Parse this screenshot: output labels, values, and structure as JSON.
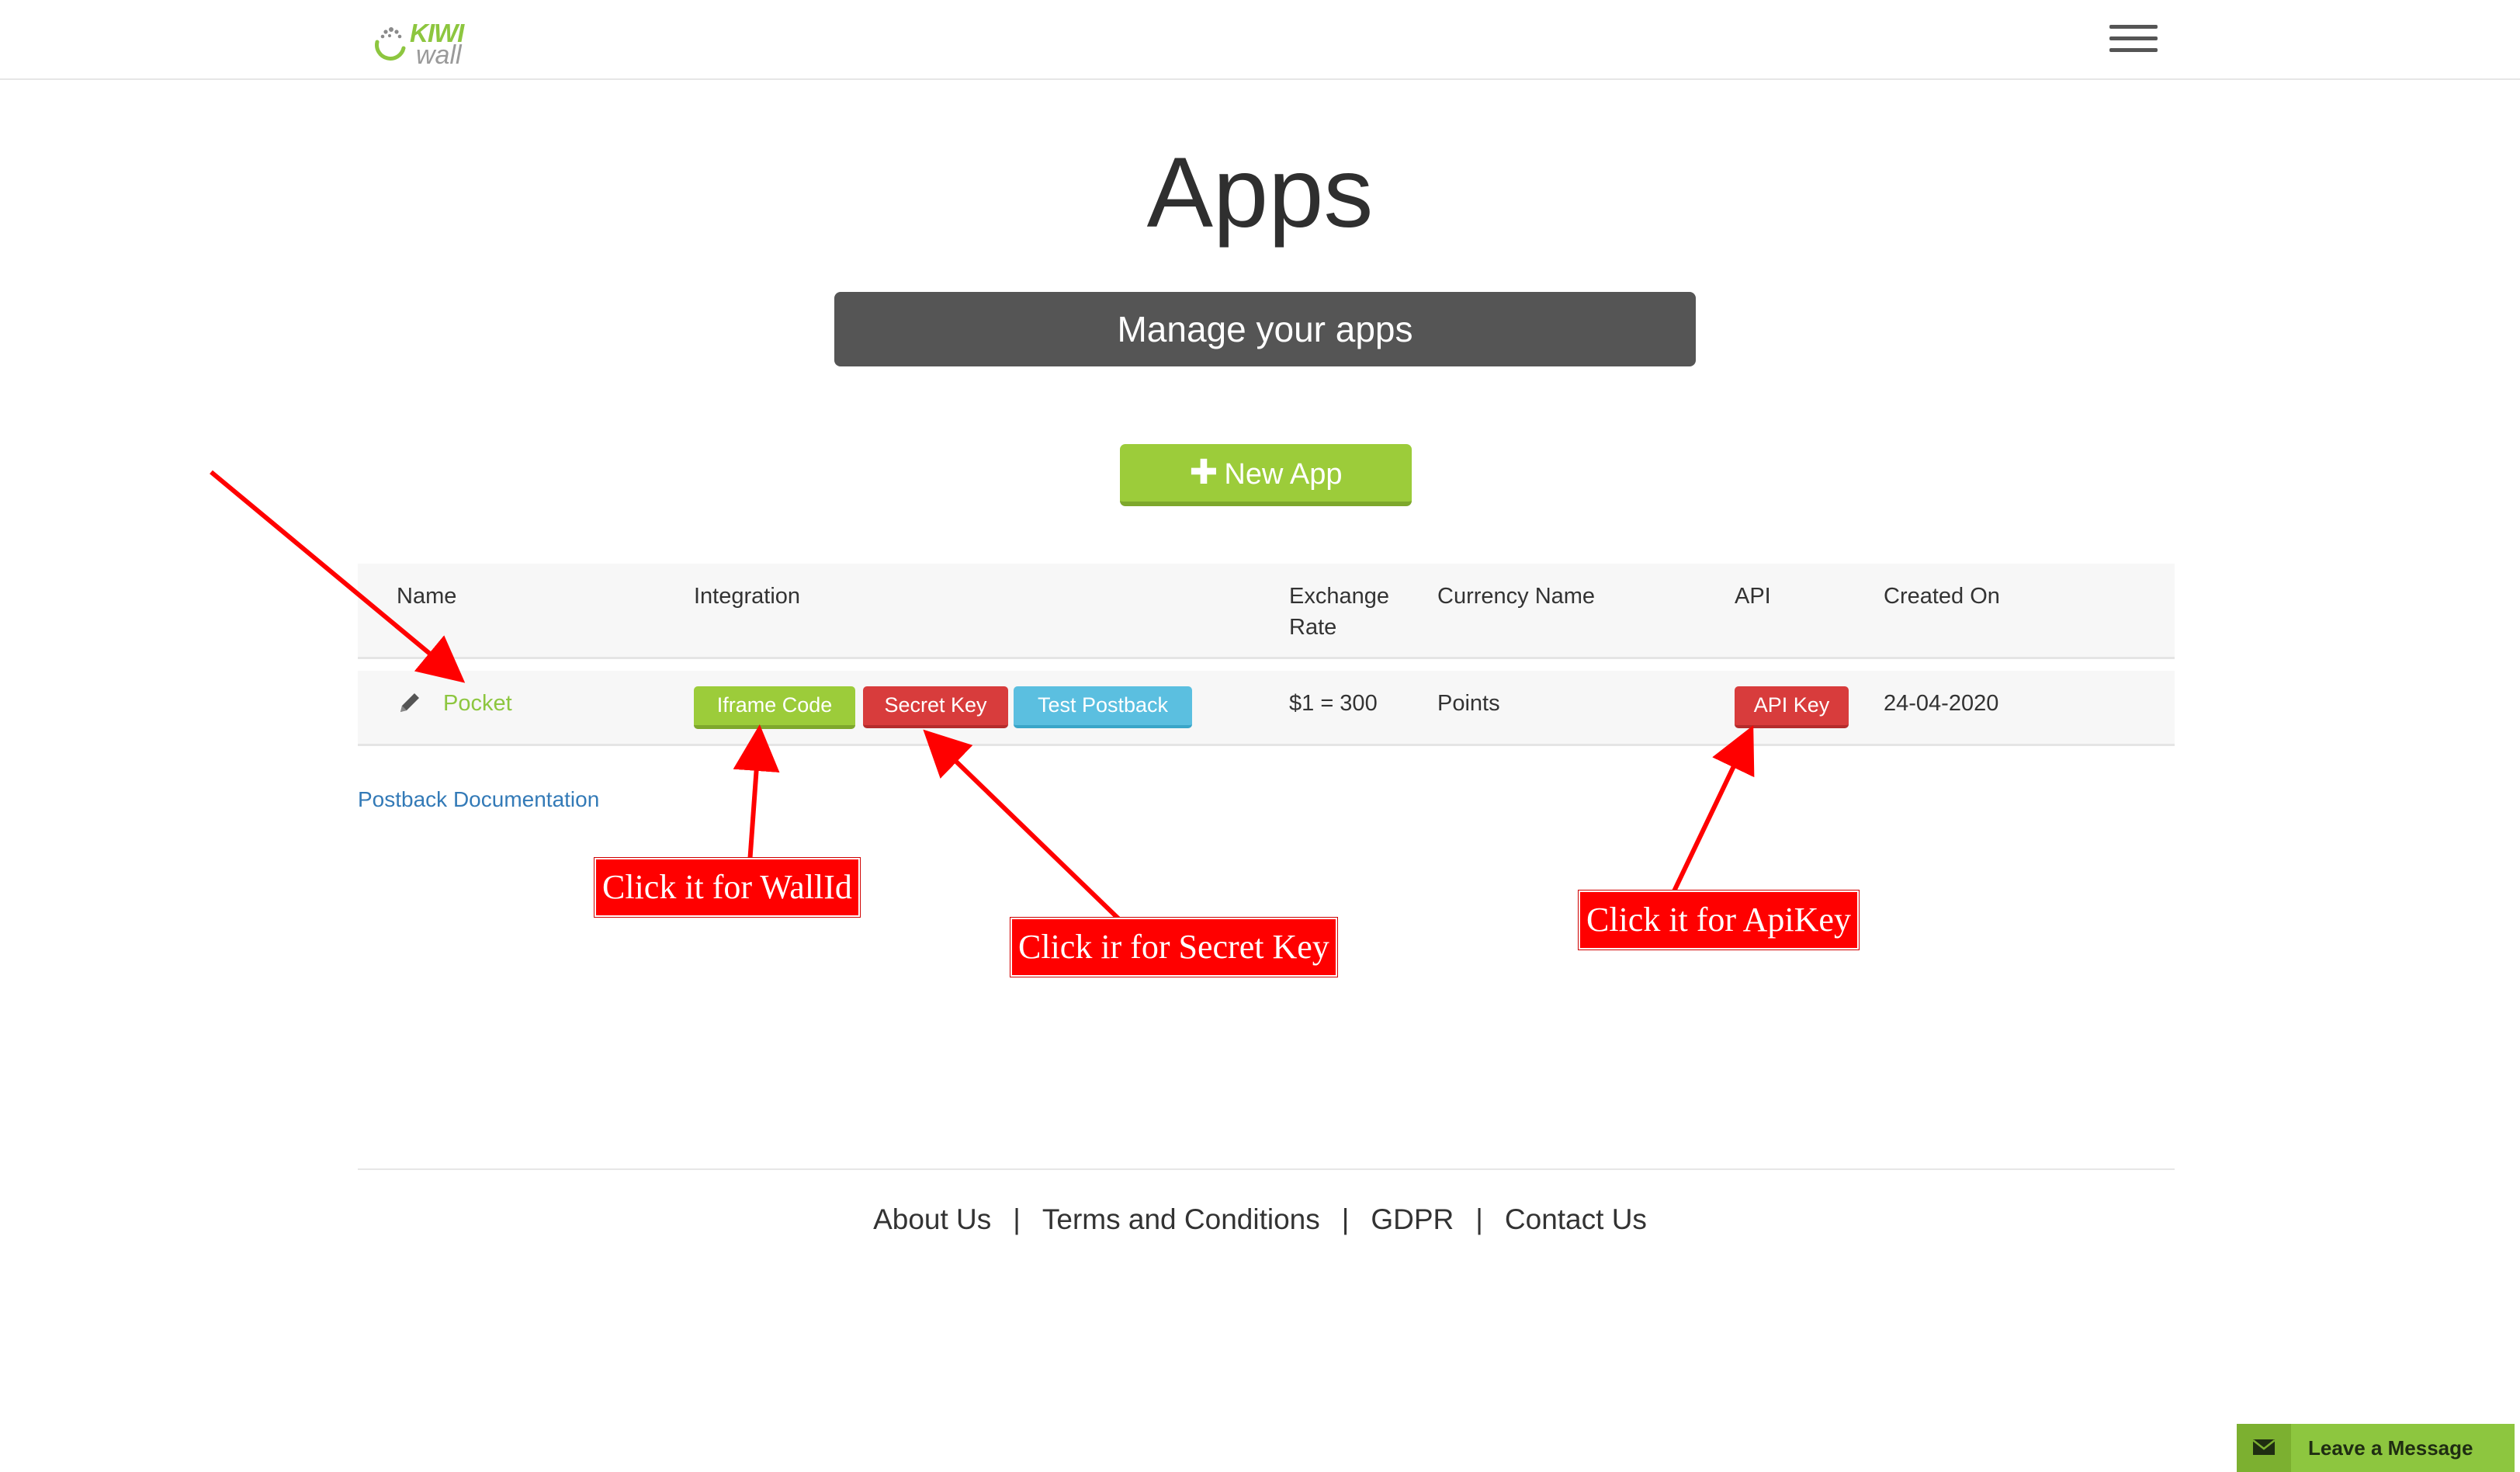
{
  "header": {
    "logo_top": "KIWI",
    "logo_bottom": "wall"
  },
  "page": {
    "title": "Apps",
    "subtitle": "Manage your apps",
    "new_app_label": "New App"
  },
  "table": {
    "columns": [
      "Name",
      "Integration",
      "Exchange Rate",
      "Currency Name",
      "API",
      "Created On"
    ],
    "rows": [
      {
        "name": "Pocket",
        "integration_buttons": [
          "Iframe Code",
          "Secret Key",
          "Test Postback"
        ],
        "exchange_rate": "$1 = 300",
        "currency_name": "Points",
        "api_button": "API Key",
        "created_on": "24-04-2020"
      }
    ]
  },
  "postback_link": "Postback Documentation",
  "annotations": {
    "wallid": "Click it for WallId",
    "secret": "Click ir for Secret Key",
    "apikey": "Click it for ApiKey"
  },
  "footer": {
    "links": [
      "About Us",
      "Terms and Conditions",
      "GDPR",
      "Contact Us"
    ]
  },
  "chat_widget": {
    "label": "Leave a Message"
  },
  "colors": {
    "brand_green": "#8dc63f",
    "button_red": "#d83c3c",
    "button_blue": "#5bbfe0",
    "annotation_red": "#ff0000"
  }
}
